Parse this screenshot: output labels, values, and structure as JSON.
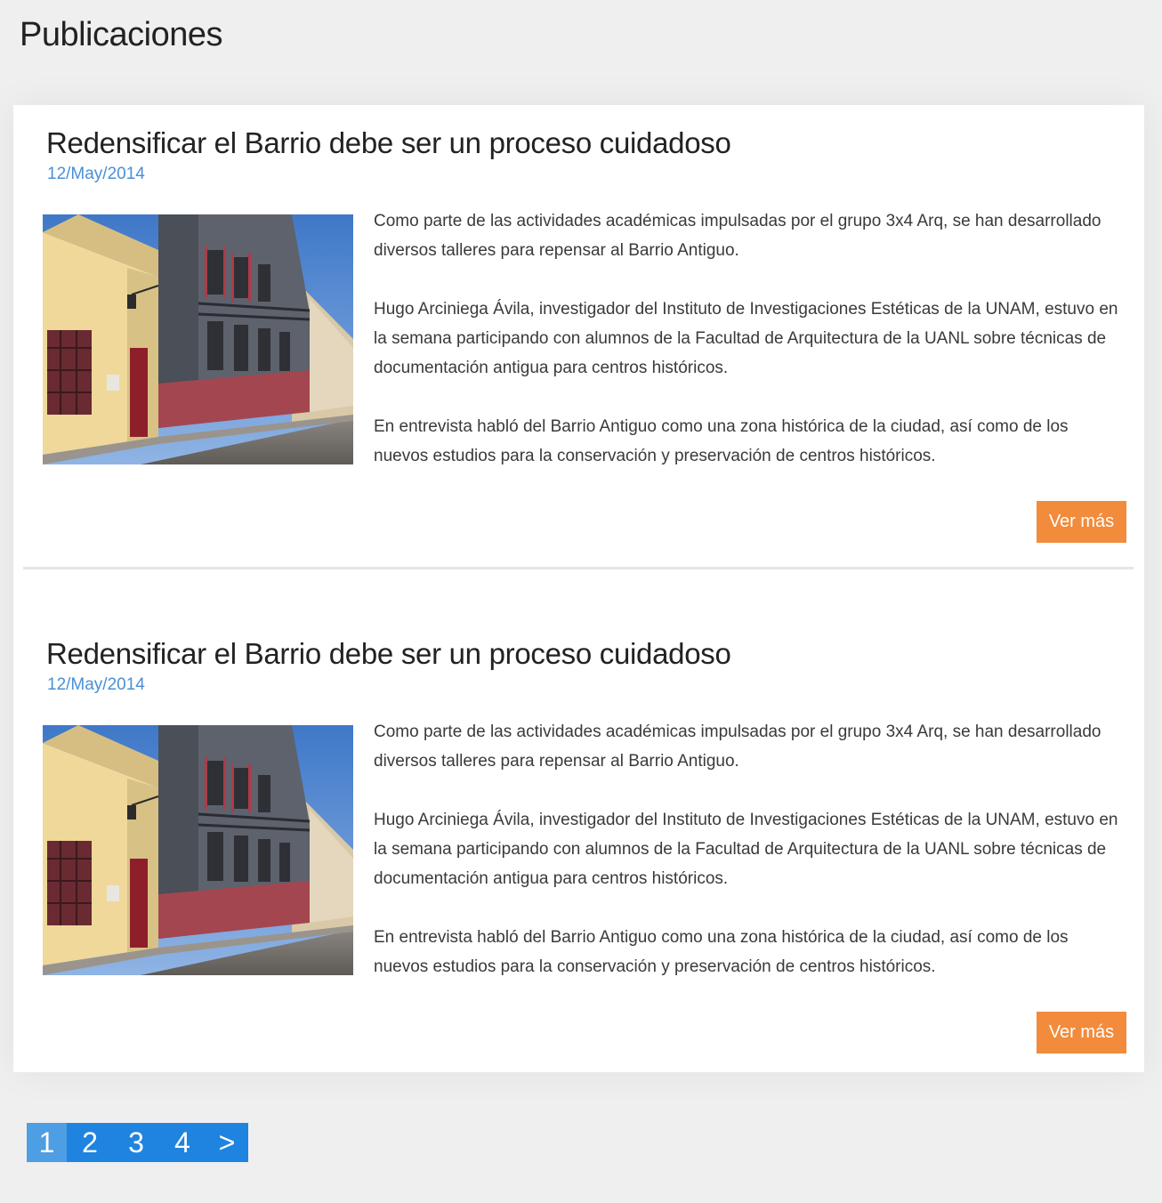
{
  "header": {
    "title": "Publicaciones"
  },
  "posts": [
    {
      "title": "Redensificar el Barrio debe ser un proceso cuidadoso",
      "date": "12/May/2014",
      "paragraphs": [
        "Como parte de las actividades académicas impulsadas por el grupo 3x4 Arq, se han desarrollado diversos talleres para repensar al Barrio Antiguo.",
        "Hugo Arciniega Ávila, investigador del Instituto de Investigaciones Estéticas de la UNAM, estuvo en la semana participando con alumnos de la Facultad de Arquitectura de la UANL sobre técnicas de documentación antigua para centros históricos.",
        "En entrevista habló del Barrio Antiguo como una zona histórica de la ciudad, así como de los nuevos  estudios para la conservación y preservación de centros históricos."
      ],
      "button_label": "Ver más"
    },
    {
      "title": "Redensificar el Barrio debe ser un proceso cuidadoso",
      "date": "12/May/2014",
      "paragraphs": [
        "Como parte de las actividades académicas impulsadas por el grupo 3x4 Arq, se han desarrollado diversos talleres para repensar al Barrio Antiguo.",
        "Hugo Arciniega Ávila, investigador del Instituto de Investigaciones Estéticas de la UNAM, estuvo en la semana participando con alumnos de la Facultad de Arquitectura de la UANL sobre técnicas de documentación antigua para centros históricos.",
        "En entrevista habló del Barrio Antiguo como una zona histórica de la ciudad, así como de los nuevos  estudios para la conservación y preservación de centros históricos."
      ],
      "button_label": "Ver más"
    }
  ],
  "pagination": {
    "pages": [
      "1",
      "2",
      "3",
      "4"
    ],
    "next_label": ">",
    "active": "1"
  },
  "colors": {
    "accent_orange": "#f28b3b",
    "date_blue": "#4a8fd6",
    "pagination_blue": "#1f84e0",
    "pagination_active": "#4d9ee3"
  }
}
